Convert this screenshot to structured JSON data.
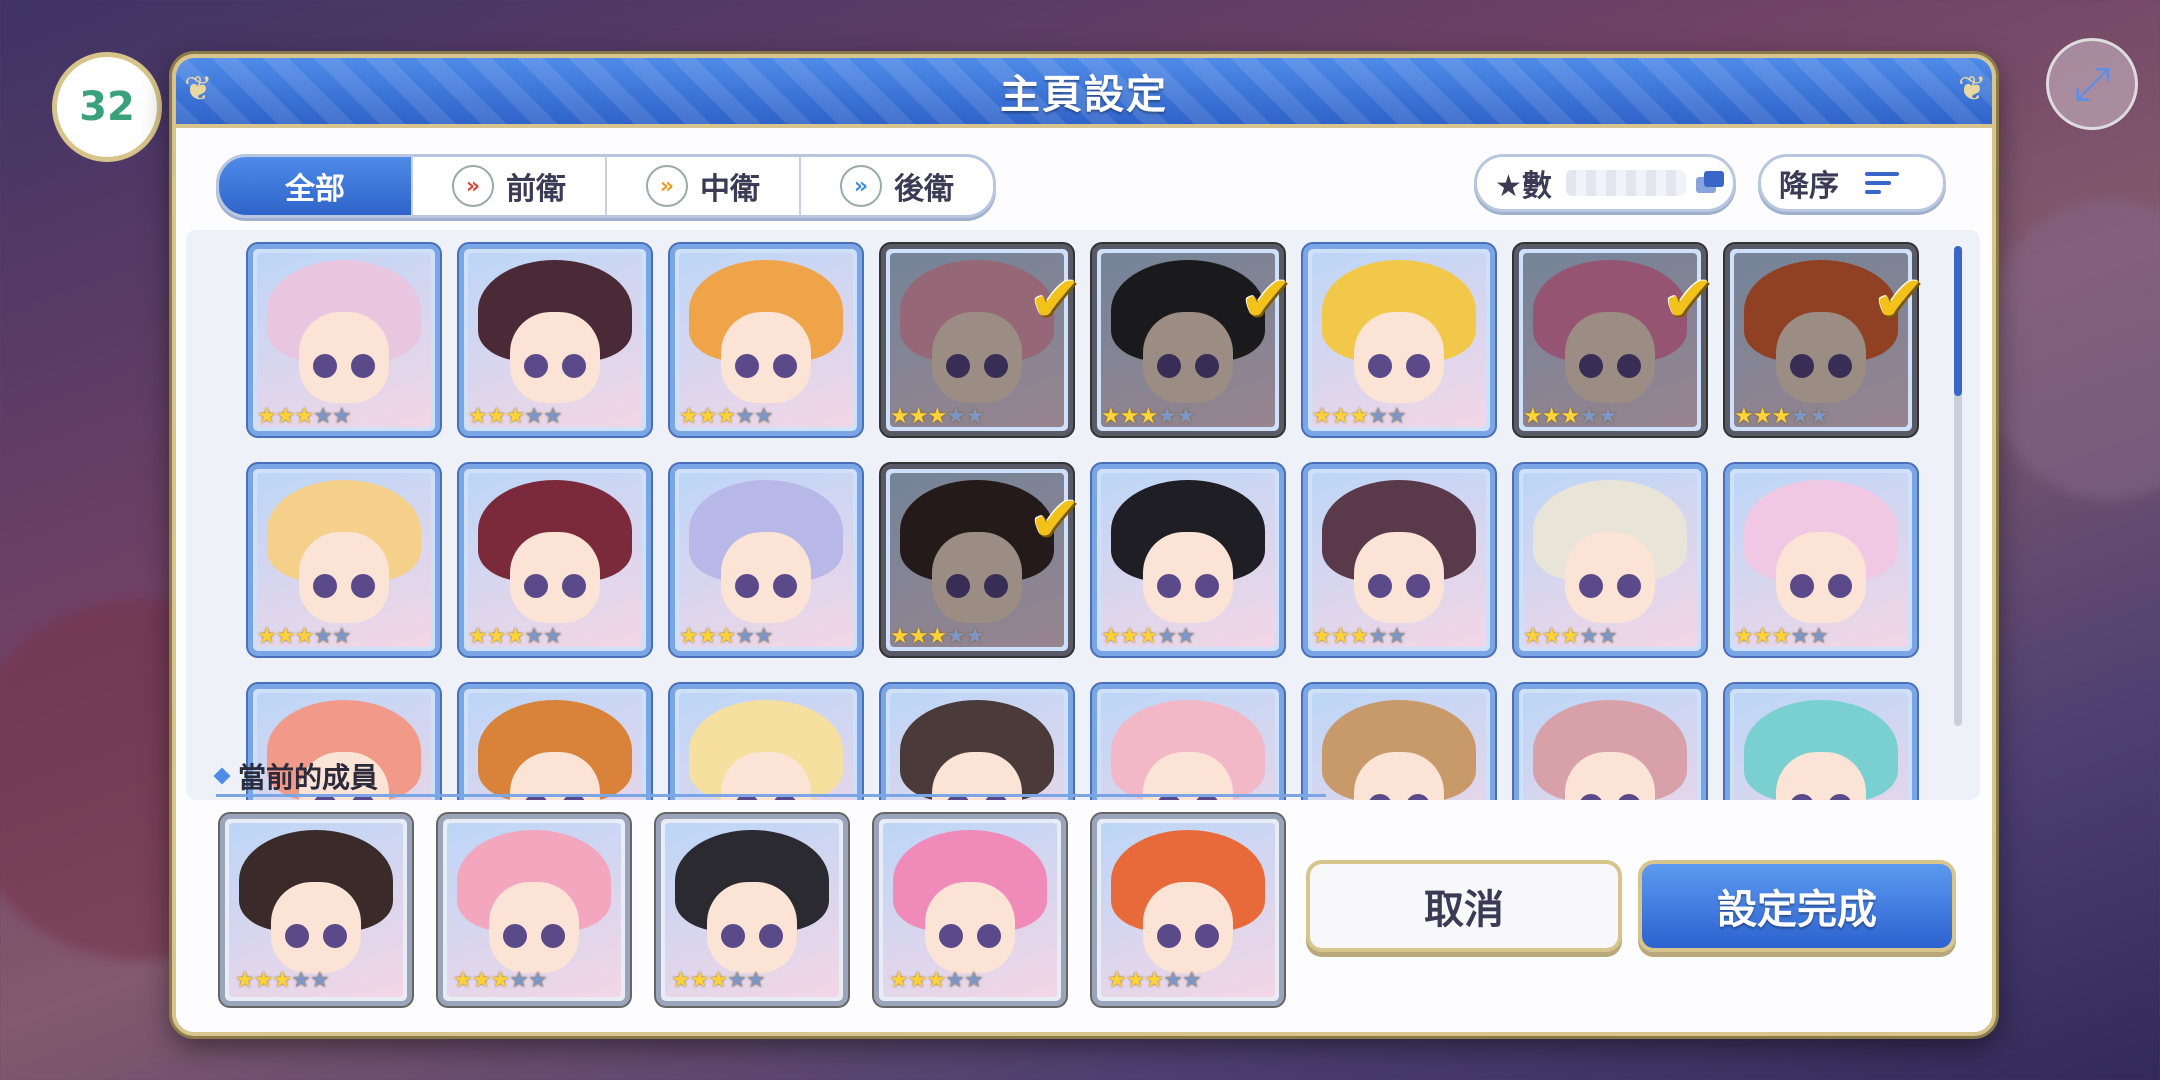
{
  "dialog": {
    "title": "主頁設定",
    "tabs": [
      {
        "label": "全部",
        "icon": "none"
      },
      {
        "label": "前衛",
        "icon": "front-role-icon"
      },
      {
        "label": "中衛",
        "icon": "middle-role-icon"
      },
      {
        "label": "後衛",
        "icon": "back-role-icon"
      }
    ],
    "sort_by_label": "★數",
    "sort_order_label": "降序",
    "section_title": "當前的成員",
    "cancel_label": "取消",
    "confirm_label": "設定完成"
  },
  "hud": {
    "player_level": "32"
  },
  "characters": [
    {
      "hair": "#e8c6e0",
      "stars": 3,
      "selected": false
    },
    {
      "hair": "#4a2a36",
      "stars": 3,
      "selected": false
    },
    {
      "hair": "#f0a44a",
      "stars": 3,
      "selected": false
    },
    {
      "hair": "#f2a7be",
      "stars": 3,
      "selected": true
    },
    {
      "hair": "#2a2a30",
      "stars": 3,
      "selected": true
    },
    {
      "hair": "#f2c84a",
      "stars": 3,
      "selected": false
    },
    {
      "hair": "#f08ab8",
      "stars": 3,
      "selected": true
    },
    {
      "hair": "#e86a3a",
      "stars": 3,
      "selected": true
    },
    {
      "hair": "#f5d08a",
      "stars": 3,
      "selected": false
    },
    {
      "hair": "#7a2a3a",
      "stars": 3,
      "selected": false
    },
    {
      "hair": "#b8b8e8",
      "stars": 3,
      "selected": false
    },
    {
      "hair": "#3a2a2a",
      "stars": 3,
      "selected": true
    },
    {
      "hair": "#1e1e24",
      "stars": 3,
      "selected": false
    },
    {
      "hair": "#5a3a4a",
      "stars": 3,
      "selected": false
    },
    {
      "hair": "#e8e4d8",
      "stars": 3,
      "selected": false
    },
    {
      "hair": "#f0c8e4",
      "stars": 3,
      "selected": false
    },
    {
      "hair": "#f29a8a",
      "stars": 0,
      "selected": false
    },
    {
      "hair": "#d8823a",
      "stars": 0,
      "selected": false
    },
    {
      "hair": "#f5e0a0",
      "stars": 0,
      "selected": false
    },
    {
      "hair": "#4a3a3a",
      "stars": 0,
      "selected": false
    },
    {
      "hair": "#f2b8c8",
      "stars": 0,
      "selected": false
    },
    {
      "hair": "#c89a6a",
      "stars": 0,
      "selected": false
    },
    {
      "hair": "#d8a0a8",
      "stars": 0,
      "selected": false
    },
    {
      "hair": "#7ad0d0",
      "stars": 0,
      "selected": false
    }
  ],
  "current_members": [
    {
      "hair": "#3a2a2a",
      "stars": 3
    },
    {
      "hair": "#f2a7be",
      "stars": 3
    },
    {
      "hair": "#2a2a30",
      "stars": 3
    },
    {
      "hair": "#f08ab8",
      "stars": 3
    },
    {
      "hair": "#e86a3a",
      "stars": 3
    }
  ],
  "max_stars": 5
}
